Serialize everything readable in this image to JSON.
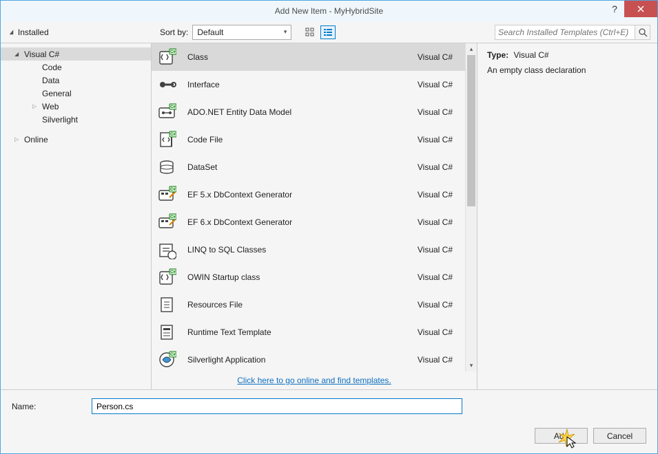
{
  "title": "Add New Item - MyHybridSite",
  "toolbar": {
    "installed_label": "Installed",
    "sort_label": "Sort by:",
    "sort_value": "Default",
    "search_placeholder": "Search Installed Templates (Ctrl+E)"
  },
  "tree": {
    "top": "Visual C#",
    "children": [
      "Code",
      "Data",
      "General",
      "Web",
      "Silverlight"
    ],
    "online": "Online"
  },
  "templates": [
    {
      "name": "Class",
      "lang": "Visual C#",
      "icon": "class",
      "selected": true
    },
    {
      "name": "Interface",
      "lang": "Visual C#",
      "icon": "interface"
    },
    {
      "name": "ADO.NET Entity Data Model",
      "lang": "Visual C#",
      "icon": "adonet"
    },
    {
      "name": "Code File",
      "lang": "Visual C#",
      "icon": "codefile"
    },
    {
      "name": "DataSet",
      "lang": "Visual C#",
      "icon": "dataset"
    },
    {
      "name": "EF 5.x DbContext Generator",
      "lang": "Visual C#",
      "icon": "ef"
    },
    {
      "name": "EF 6.x DbContext Generator",
      "lang": "Visual C#",
      "icon": "ef"
    },
    {
      "name": "LINQ to SQL Classes",
      "lang": "Visual C#",
      "icon": "linq"
    },
    {
      "name": "OWIN Startup class",
      "lang": "Visual C#",
      "icon": "class"
    },
    {
      "name": "Resources File",
      "lang": "Visual C#",
      "icon": "resources"
    },
    {
      "name": "Runtime Text Template",
      "lang": "Visual C#",
      "icon": "template"
    },
    {
      "name": "Silverlight Application",
      "lang": "Visual C#",
      "icon": "silverlight"
    }
  ],
  "details": {
    "type_label": "Type:",
    "type_value": "Visual C#",
    "description": "An empty class declaration"
  },
  "link": "Click here to go online and find templates.",
  "name": {
    "label": "Name:",
    "value": "Person.cs"
  },
  "buttons": {
    "add": "Add",
    "cancel": "Cancel"
  }
}
